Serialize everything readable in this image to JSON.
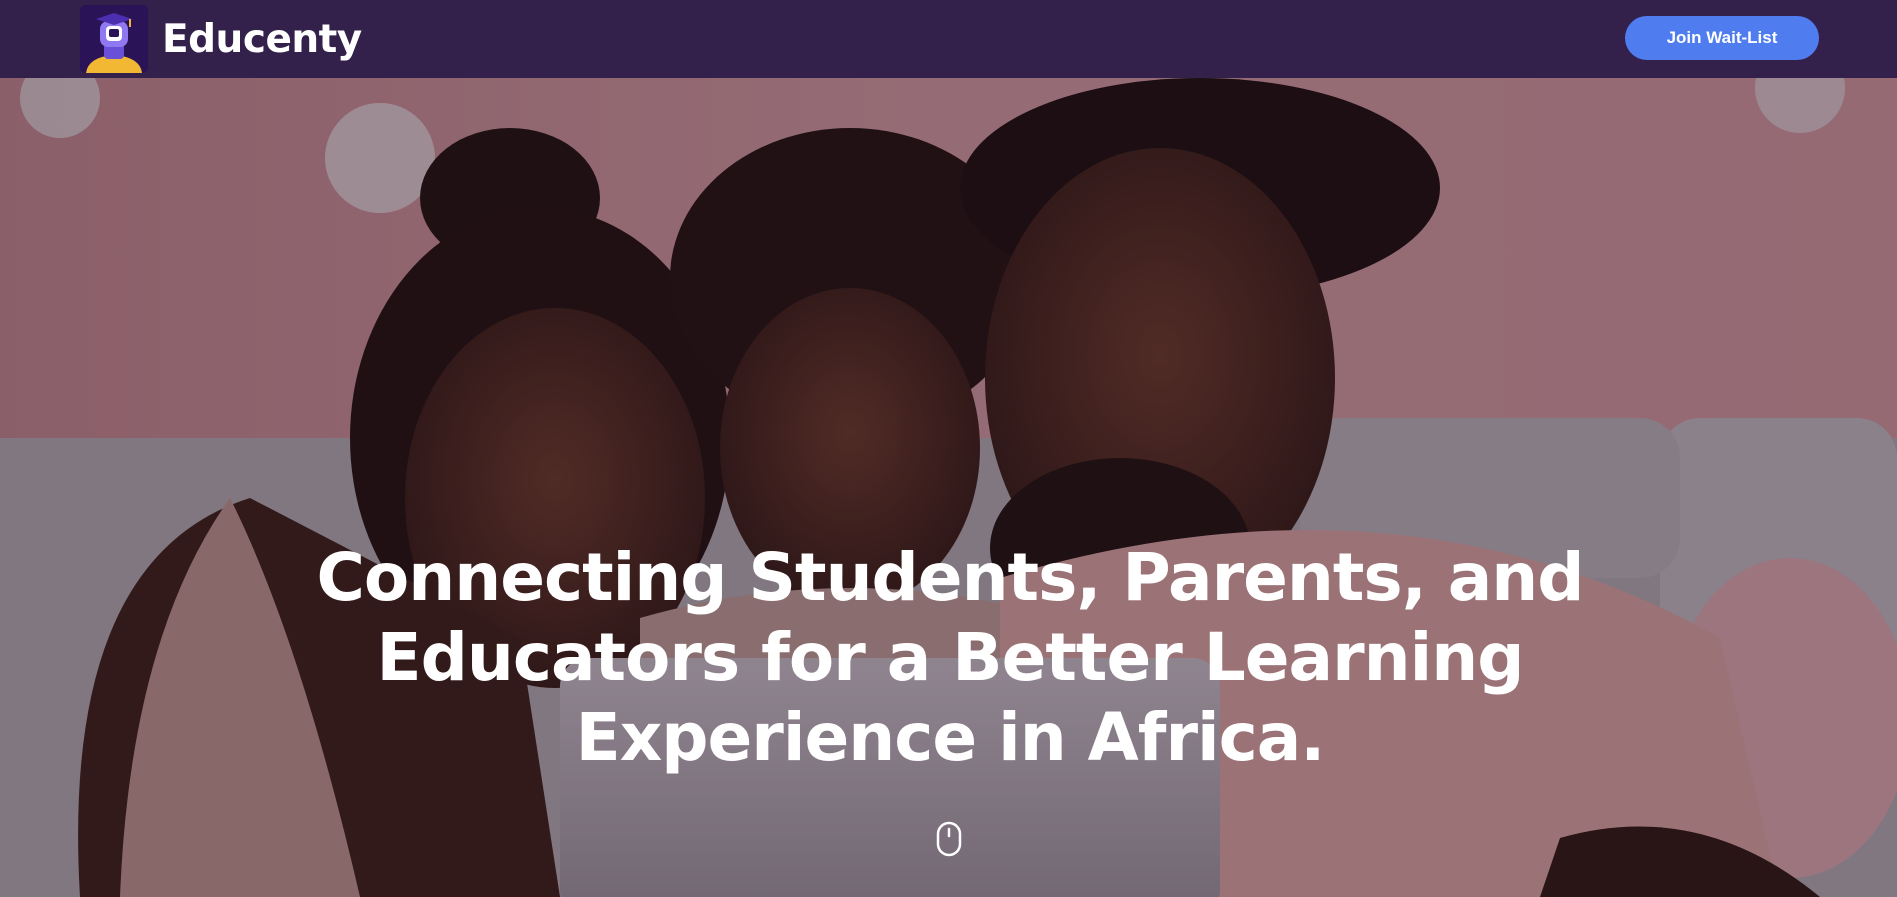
{
  "navbar": {
    "brand_name": "Educenty",
    "logo_icon": "graduate-avatar-icon",
    "join_button_label": "Join Wait-List"
  },
  "hero": {
    "image_description_icon": "family-with-tablet-photo",
    "headline_lines": [
      "Connecting Students, Parents, and",
      "Educators for a Better Learning",
      "Experience in Africa."
    ],
    "scroll_icon": "mouse-scroll-icon"
  },
  "colors": {
    "navbar_bg": "#33214c",
    "button_bg": "#4f7df0",
    "headline_text": "#ffffff"
  }
}
